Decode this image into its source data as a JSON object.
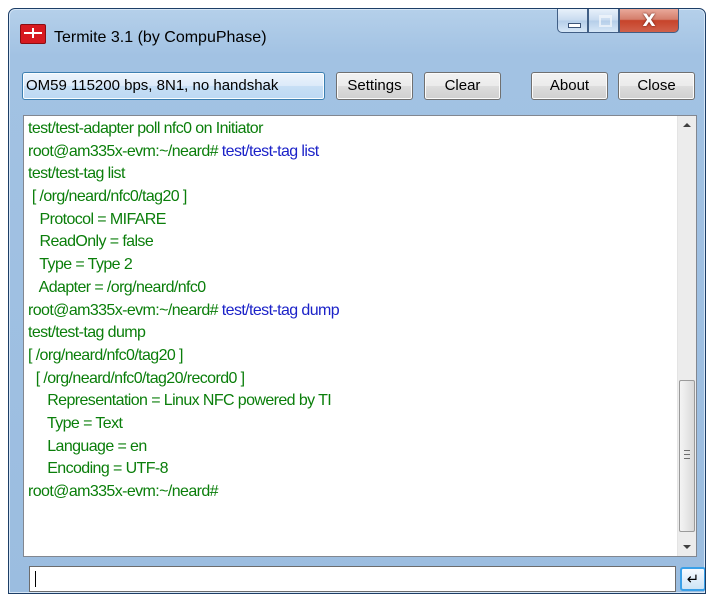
{
  "window": {
    "title": "Termite 3.1 (by CompuPhase)",
    "close_glyph": "X",
    "icons": {
      "app": "termite-app-icon",
      "minimize": "minimize-icon",
      "maximize": "maximize-icon",
      "close": "close-icon"
    }
  },
  "toolbar": {
    "port_status": "OM59 115200 bps, 8N1, no handshak",
    "settings_label": "Settings",
    "clear_label": "Clear",
    "about_label": "About",
    "close_label": "Close"
  },
  "terminal": {
    "lines": [
      {
        "segments": [
          {
            "text": "test/test-adapter poll nfc0 on Initiator",
            "kind": "output"
          }
        ]
      },
      {
        "segments": [
          {
            "text": "root@am335x-evm:~/neard# ",
            "kind": "output"
          },
          {
            "text": "test/test-tag list",
            "kind": "command"
          }
        ]
      },
      {
        "segments": [
          {
            "text": "test/test-tag list",
            "kind": "output"
          }
        ]
      },
      {
        "segments": [
          {
            "text": " [ /org/neard/nfc0/tag20 ]",
            "kind": "output"
          }
        ]
      },
      {
        "segments": [
          {
            "text": "   Protocol = MIFARE",
            "kind": "output"
          }
        ]
      },
      {
        "segments": [
          {
            "text": "   ReadOnly = false",
            "kind": "output"
          }
        ]
      },
      {
        "segments": [
          {
            "text": "   Type = Type 2",
            "kind": "output"
          }
        ]
      },
      {
        "segments": [
          {
            "text": "   Adapter = /org/neard/nfc0",
            "kind": "output"
          }
        ]
      },
      {
        "segments": [
          {
            "text": "root@am335x-evm:~/neard# ",
            "kind": "output"
          },
          {
            "text": "test/test-tag dump",
            "kind": "command"
          }
        ]
      },
      {
        "segments": [
          {
            "text": "test/test-tag dump",
            "kind": "output"
          }
        ]
      },
      {
        "segments": [
          {
            "text": "[ /org/neard/nfc0/tag20 ]",
            "kind": "output"
          }
        ]
      },
      {
        "segments": [
          {
            "text": "  [ /org/neard/nfc0/tag20/record0 ]",
            "kind": "output"
          }
        ]
      },
      {
        "segments": [
          {
            "text": "     Representation = Linux NFC powered by TI",
            "kind": "output"
          }
        ]
      },
      {
        "segments": [
          {
            "text": "     Type = Text",
            "kind": "output"
          }
        ]
      },
      {
        "segments": [
          {
            "text": "     Language = en",
            "kind": "output"
          }
        ]
      },
      {
        "segments": [
          {
            "text": "     Encoding = UTF-8",
            "kind": "output"
          }
        ]
      },
      {
        "segments": [
          {
            "text": "root@am335x-evm:~/neard#",
            "kind": "output"
          }
        ]
      }
    ],
    "colors": {
      "output": "#0a7e0a",
      "command": "#1b22c8"
    },
    "scroll_position": 0.9
  },
  "input": {
    "value": "",
    "send_glyph": "↵",
    "send_icon": "enter-icon"
  }
}
